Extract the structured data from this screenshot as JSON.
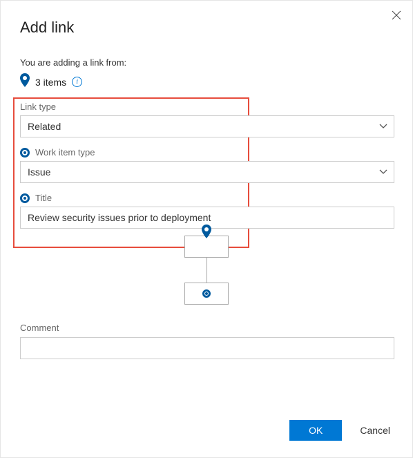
{
  "dialog": {
    "title": "Add link",
    "subtext": "You are adding a link from:",
    "items_count": "3 items"
  },
  "fields": {
    "link_type": {
      "label": "Link type",
      "value": "Related"
    },
    "work_item_type": {
      "label": "Work item type",
      "value": "Issue"
    },
    "title": {
      "label": "Title",
      "value": "Review security issues prior to deployment"
    },
    "comment": {
      "label": "Comment",
      "value": ""
    }
  },
  "buttons": {
    "ok": "OK",
    "cancel": "Cancel"
  }
}
